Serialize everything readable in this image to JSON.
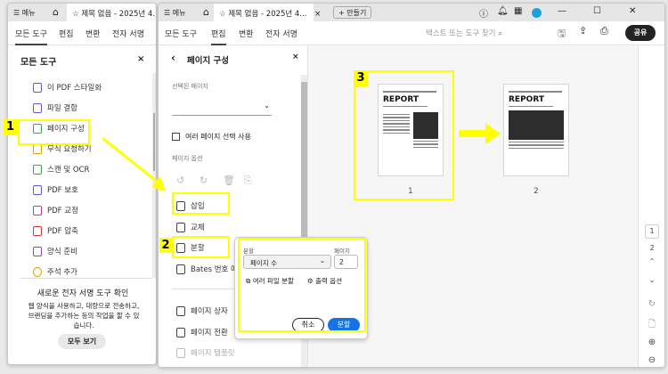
{
  "left_window": {
    "menu_label": "메뉴",
    "doc_tab": "제목 없음 - 2025년 4...",
    "tabs": [
      "모든 도구",
      "편집",
      "변환",
      "전자 서명"
    ],
    "panel_title": "모든 도구",
    "close": "×",
    "tools": [
      "이 PDF 스타일화",
      "파일 결합",
      "페이지 구성",
      "무식 요청하기",
      "스캔 및 OCR",
      "PDF 보호",
      "PDF 교정",
      "PDF 압축",
      "양식 준비",
      "주석 추가"
    ],
    "promo_title": "새로운 전자 서명 도구 확인",
    "promo_text": "웹 양식을 사용하고, 대량으로 전송하고, 브랜딩을 추가하는 등의 작업을 할 수 있습니다.",
    "promo_button": "모두 보기"
  },
  "main_window": {
    "menu_label": "메뉴",
    "doc_tab": "제목 없음 - 2025년 4...",
    "tab_close": "×",
    "create_button": "+ 만들기",
    "tabs": [
      "모든 도구",
      "편집",
      "변환",
      "전자 서명"
    ],
    "search_placeholder": "텍스트 또는 도구 찾기",
    "share_button": "공유",
    "panel": {
      "title": "페이지 구성",
      "close": "×",
      "selected_pages_label": "선택된 페이지",
      "multi_select_label": "여러 페이지 선택 사용",
      "page_options_label": "페이지 옵션",
      "actions": [
        "삽입",
        "교체",
        "분할",
        "Bates 번호 매",
        "페이지 상자 ",
        "페이지 전환",
        "페이지 템플릿"
      ]
    },
    "split_popup": {
      "split_label": "분할",
      "page_label": "페이지",
      "split_by": "페이지 수",
      "page_value": "2",
      "multi_file": "여러 파일 분할",
      "output_options": "출력 옵션",
      "cancel": "취소",
      "confirm": "분할"
    },
    "pages": [
      {
        "number": "1",
        "title": "REPORT"
      },
      {
        "number": "2",
        "title": "REPORT"
      }
    ],
    "rail": {
      "page1": "1",
      "page2": "2"
    },
    "accent": "#1473e6"
  },
  "annotations": [
    "1",
    "2",
    "3"
  ]
}
